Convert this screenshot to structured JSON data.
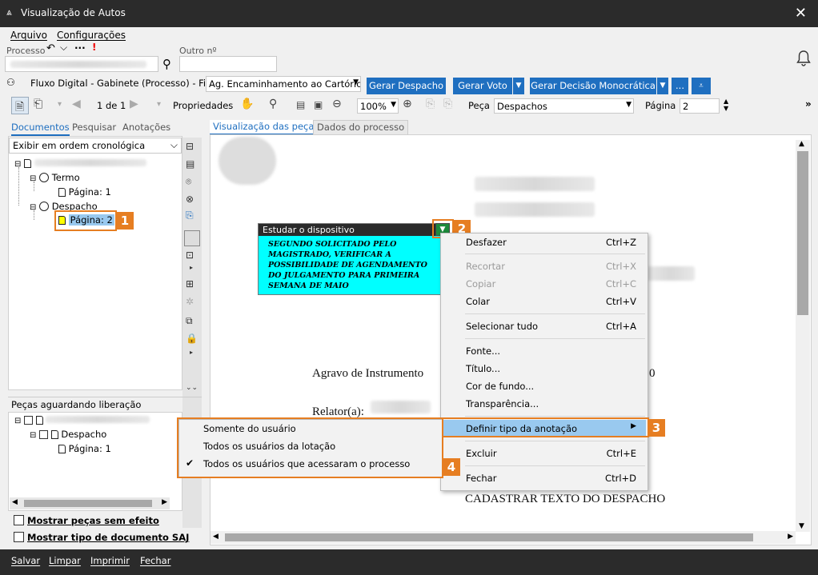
{
  "window": {
    "title": "Visualização de Autos",
    "close": "✕"
  },
  "menu": {
    "arquivo": "Arquivo",
    "configuracoes": "Configurações"
  },
  "header": {
    "processo_label": "Processo",
    "outro_label": "Outro nº",
    "back_glyph": "↶",
    "chev_glyph": "⌵",
    "more_glyph": "···",
    "alert_glyph": "!",
    "search_glyph": "⚲"
  },
  "fluxo": {
    "text": "Fluxo Digital - Gabinete (Processo) - Fila:",
    "fila_value": "Ag. Encaminhamento ao Cartório",
    "buttons": {
      "despacho": "Gerar Despacho",
      "voto": "Gerar Voto",
      "decisao": "Gerar Decisão Monocrática",
      "more": "..."
    }
  },
  "toolbar": {
    "pages": "1 de 1",
    "propriedades": "Propriedades",
    "zoom": "100%",
    "peca_label": "Peça",
    "peca_value": "Despachos",
    "pagina_label": "Página",
    "pagina_value": "2"
  },
  "left_tabs": {
    "documentos": "Documentos",
    "pesquisar": "Pesquisar",
    "anotacoes": "Anotações"
  },
  "order_select": "Exibir em ordem cronológica",
  "tree": {
    "termo": "Termo",
    "termo_page": "Página: 1",
    "despacho": "Despacho",
    "despacho_page": "Página: 2"
  },
  "pending": {
    "title": "Peças aguardando liberação",
    "despacho": "Despacho",
    "page": "Página: 1"
  },
  "checks": {
    "sem_efeito": "Mostrar peças sem efeito",
    "tipo_doc": "Mostrar tipo de documento SAJ"
  },
  "viewer_tabs": {
    "visualizacao": "Visualização das peças",
    "dados": "Dados do processo"
  },
  "document": {
    "agravo": "Agravo de Instrumento",
    "relator": "Relator(a):",
    "tail_digit": "0",
    "cadastrar": "CADASTRAR TEXTO DO DESPACHO"
  },
  "note": {
    "header": "Estudar o dispositivo",
    "text": "SEGUNDO SOLICITADO PELO MAGISTRADO, VERIFICAR A POSSIBILIDADE DE AGENDAMENTO DO JULGAMENTO PARA PRIMEIRA SEMANA DE MAIO"
  },
  "context_menu": {
    "desfazer": "Desfazer",
    "desfazer_sc": "Ctrl+Z",
    "recortar": "Recortar",
    "recortar_sc": "Ctrl+X",
    "copiar": "Copiar",
    "copiar_sc": "Ctrl+C",
    "colar": "Colar",
    "colar_sc": "Ctrl+V",
    "selecionar": "Selecionar tudo",
    "selecionar_sc": "Ctrl+A",
    "fonte": "Fonte...",
    "titulo": "Título...",
    "cor": "Cor de fundo...",
    "transparencia": "Transparência...",
    "definir": "Definir tipo da anotação",
    "excluir": "Excluir",
    "excluir_sc": "Ctrl+E",
    "fechar": "Fechar",
    "fechar_sc": "Ctrl+D"
  },
  "submenu": {
    "somente": "Somente do usuário",
    "todos_lotacao": "Todos os usuários da lotação",
    "todos_acessaram": "Todos os usuários que acessaram o processo"
  },
  "badges": {
    "b1": "1",
    "b2": "2",
    "b3": "3",
    "b4": "4"
  },
  "statusbar": {
    "salvar": "Salvar",
    "limpar": "Limpar",
    "imprimir": "Imprimir",
    "fechar": "Fechar"
  },
  "colors": {
    "accent": "#1f6fc0",
    "highlight": "#e67e22",
    "note_bg": "#00ffff"
  }
}
